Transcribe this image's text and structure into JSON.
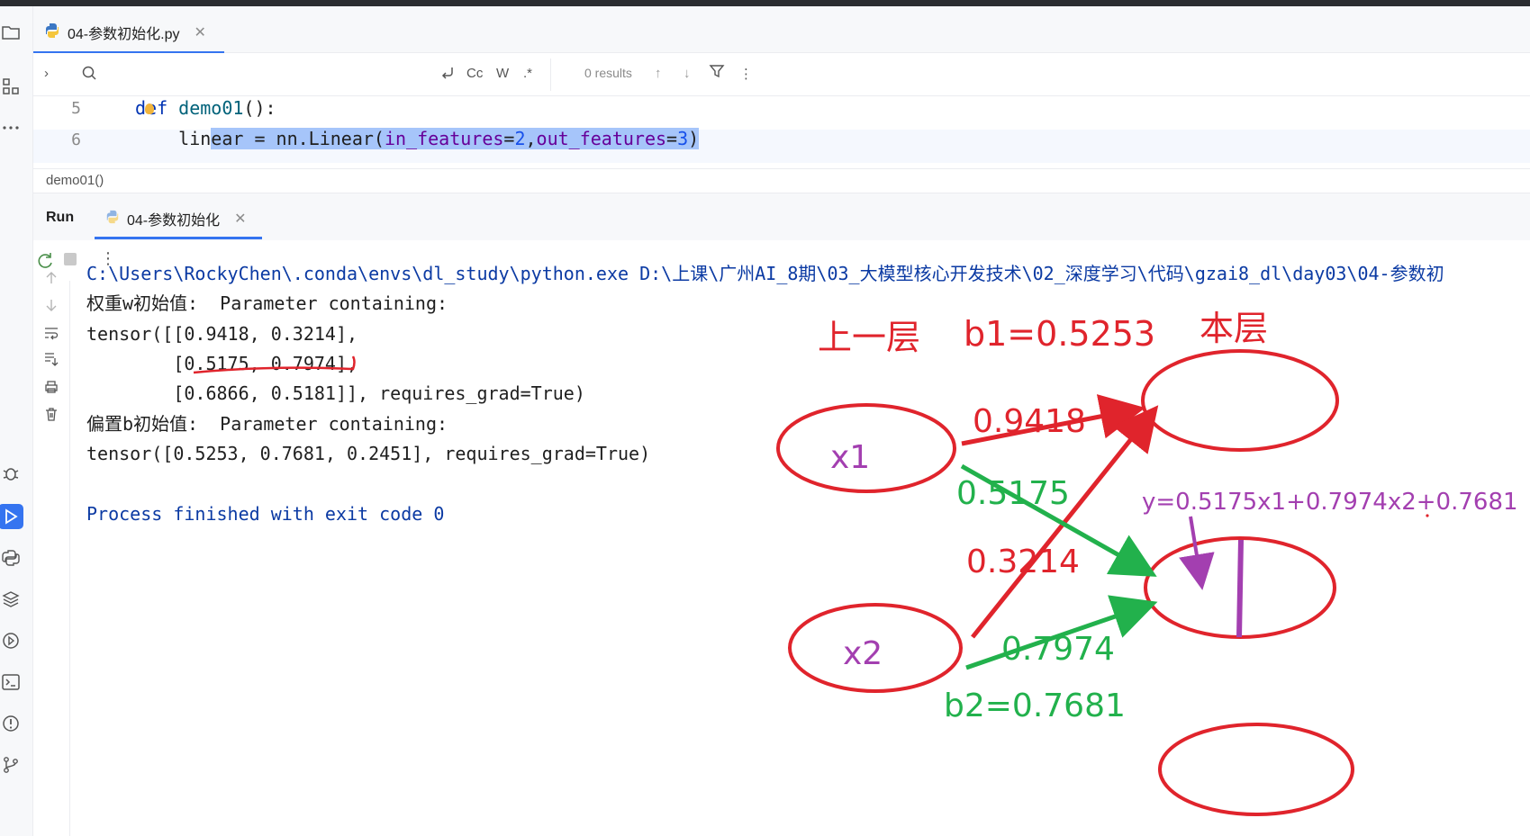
{
  "editor": {
    "file_tab": "04-参数初始化.py",
    "find": {
      "results": "0 results",
      "case_btn": "Cc",
      "word_btn": "W",
      "regex_btn": ".*"
    },
    "lines": [
      {
        "num": "5",
        "code_kw": "def ",
        "code_fn": "demo01",
        "code_rest": "():"
      },
      {
        "num": "6",
        "indent": "    ",
        "pre": "lin",
        "sel_a": "ear = nn.Linear(",
        "param1": "in_features",
        "eq1": "=",
        "v1": "2",
        "comma": ",",
        "param2": "out_features",
        "eq2": "=",
        "v2": "3",
        "close": ")"
      }
    ],
    "breadcrumb": "demo01()"
  },
  "run": {
    "label": "Run",
    "tab": "04-参数初始化",
    "console": [
      "C:\\Users\\RockyChen\\.conda\\envs\\dl_study\\python.exe D:\\上课\\广州AI_8期\\03_大模型核心开发技术\\02_深度学习\\代码\\gzai8_dl\\day03\\04-参数初",
      "权重w初始值:  Parameter containing:",
      "tensor([[0.9418, 0.3214],",
      "        [0.5175, 0.7974],",
      "        [0.6866, 0.5181]], requires_grad=True)",
      "偏置b初始值:  Parameter containing:",
      "tensor([0.5253, 0.7681, 0.2451], requires_grad=True)",
      "",
      "Process finished with exit code 0"
    ]
  },
  "annotation": {
    "prev_layer": "上一层",
    "b1": "b1=0.5253",
    "this_layer": "本层",
    "x1": "x1",
    "x2": "x2",
    "w11": "0.9418",
    "w12": "0.5175",
    "w21": "0.3214",
    "w22": "0.7974",
    "b2": "b2=0.7681",
    "formula": "y=0.5175x1+0.7974x2+0.7681",
    "colors": {
      "red": "#e0242c",
      "green": "#22b14c",
      "purple": "#a33fb0"
    }
  }
}
